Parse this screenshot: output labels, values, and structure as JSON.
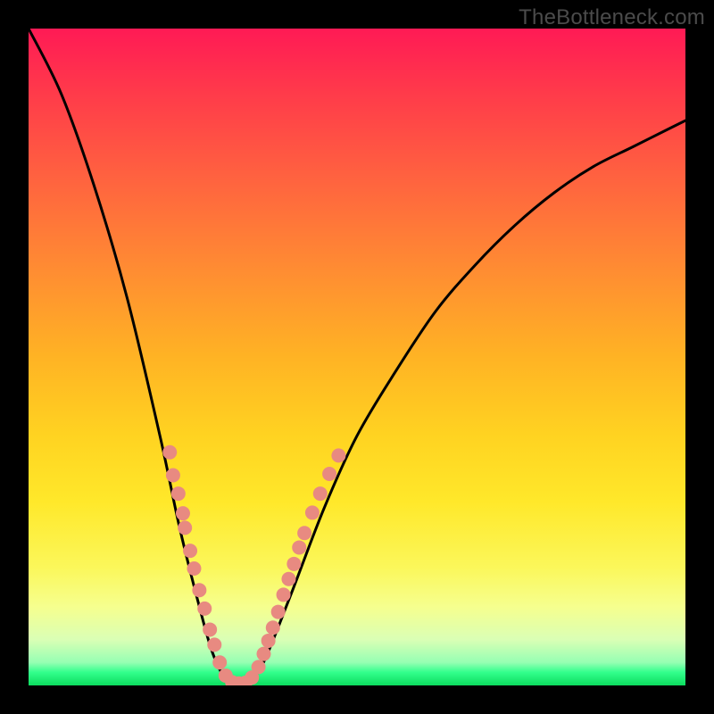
{
  "watermark": "TheBottleneck.com",
  "colors": {
    "curve": "#000000",
    "dots": "#e88a81",
    "background_frame": "#000000"
  },
  "chart_data": {
    "type": "line",
    "title": "",
    "xlabel": "",
    "ylabel": "",
    "xlim": [
      0,
      1
    ],
    "ylim": [
      0,
      1
    ],
    "series": [
      {
        "name": "bottleneck-curve",
        "x": [
          0.0,
          0.05,
          0.1,
          0.15,
          0.2,
          0.23,
          0.26,
          0.28,
          0.3,
          0.32,
          0.34,
          0.36,
          0.4,
          0.45,
          0.5,
          0.56,
          0.62,
          0.68,
          0.74,
          0.8,
          0.86,
          0.92,
          0.98,
          1.0
        ],
        "y": [
          1.0,
          0.9,
          0.76,
          0.59,
          0.38,
          0.24,
          0.12,
          0.05,
          0.01,
          0.0,
          0.01,
          0.04,
          0.14,
          0.27,
          0.38,
          0.48,
          0.57,
          0.64,
          0.7,
          0.75,
          0.79,
          0.82,
          0.85,
          0.86
        ]
      }
    ],
    "scatter_points": {
      "name": "overlay-dots",
      "points": [
        {
          "x": 0.215,
          "y": 0.355
        },
        {
          "x": 0.22,
          "y": 0.32
        },
        {
          "x": 0.228,
          "y": 0.292
        },
        {
          "x": 0.235,
          "y": 0.262
        },
        {
          "x": 0.238,
          "y": 0.24
        },
        {
          "x": 0.246,
          "y": 0.205
        },
        {
          "x": 0.252,
          "y": 0.178
        },
        {
          "x": 0.26,
          "y": 0.145
        },
        {
          "x": 0.268,
          "y": 0.117
        },
        {
          "x": 0.276,
          "y": 0.085
        },
        {
          "x": 0.283,
          "y": 0.062
        },
        {
          "x": 0.291,
          "y": 0.035
        },
        {
          "x": 0.3,
          "y": 0.015
        },
        {
          "x": 0.31,
          "y": 0.005
        },
        {
          "x": 0.32,
          "y": 0.003
        },
        {
          "x": 0.33,
          "y": 0.004
        },
        {
          "x": 0.34,
          "y": 0.012
        },
        {
          "x": 0.35,
          "y": 0.028
        },
        {
          "x": 0.358,
          "y": 0.048
        },
        {
          "x": 0.365,
          "y": 0.068
        },
        {
          "x": 0.372,
          "y": 0.088
        },
        {
          "x": 0.38,
          "y": 0.112
        },
        {
          "x": 0.388,
          "y": 0.138
        },
        {
          "x": 0.396,
          "y": 0.162
        },
        {
          "x": 0.404,
          "y": 0.185
        },
        {
          "x": 0.412,
          "y": 0.21
        },
        {
          "x": 0.42,
          "y": 0.232
        },
        {
          "x": 0.432,
          "y": 0.263
        },
        {
          "x": 0.444,
          "y": 0.292
        },
        {
          "x": 0.458,
          "y": 0.322
        },
        {
          "x": 0.472,
          "y": 0.35
        }
      ]
    }
  }
}
